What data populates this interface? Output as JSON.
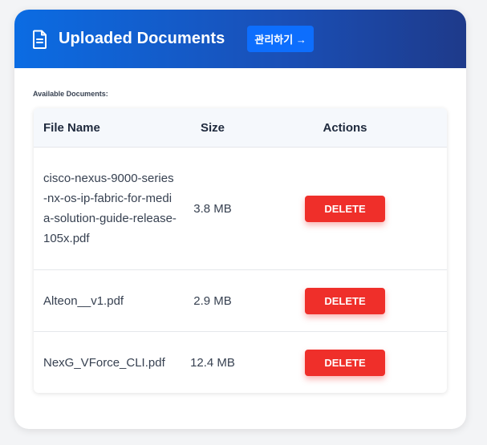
{
  "header": {
    "title": "Uploaded Documents",
    "manage_label": "관리하기 →",
    "icon": "document-icon"
  },
  "section_label": "Available Documents:",
  "table": {
    "columns": [
      "File Name",
      "Size",
      "Actions"
    ],
    "rows": [
      {
        "name": "cisco-nexus-9000-series-nx-os-ip-fabric-for-media-solution-guide-release-105x.pdf",
        "size": "3.8 MB",
        "action": "DELETE"
      },
      {
        "name": "Alteon__v1.pdf",
        "size": "2.9 MB",
        "action": "DELETE"
      },
      {
        "name": "NexG_VForce_CLI.pdf",
        "size": "12.4 MB",
        "action": "DELETE"
      }
    ]
  },
  "colors": {
    "header_start": "#0b6ce3",
    "header_end": "#1e3a8a",
    "manage_button": "#0d6efd",
    "delete_button": "#ef2f2a"
  }
}
